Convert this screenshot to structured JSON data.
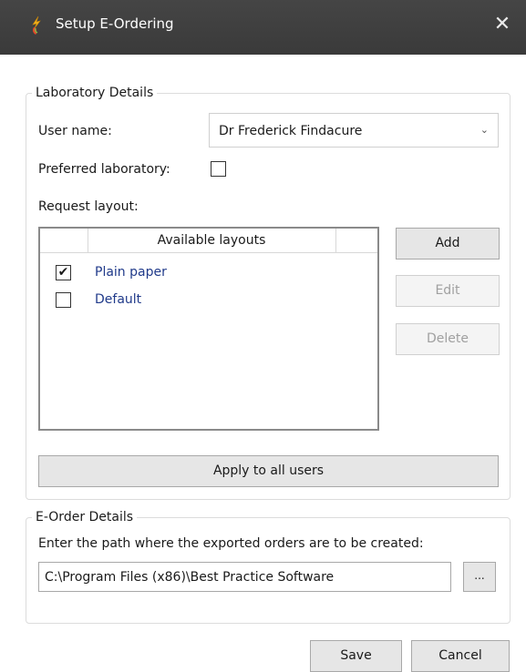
{
  "window": {
    "title": "Setup E-Ordering",
    "close_symbol": "✕",
    "icon": "app-icon"
  },
  "laboratory_details": {
    "legend": "Laboratory Details",
    "user_name_label": "User name:",
    "user_name_value": "Dr Frederick Findacure",
    "preferred_lab_label": "Preferred laboratory:",
    "preferred_lab_checked": false,
    "request_layout_label": "Request layout:",
    "layouts_header": "Available layouts",
    "layouts": [
      {
        "name": "Plain paper",
        "checked": true,
        "check_mark": "✔"
      },
      {
        "name": "Default",
        "checked": false,
        "check_mark": ""
      }
    ],
    "buttons": {
      "add": "Add",
      "edit": "Edit",
      "delete": "Delete",
      "apply_all": "Apply to all users"
    }
  },
  "e_order_details": {
    "legend": "E-Order Details",
    "path_label": "Enter the path where the exported orders are to be created:",
    "path_value": "C:\\Program Files (x86)\\Best Practice Software",
    "browse_label": "..."
  },
  "footer": {
    "save": "Save",
    "cancel": "Cancel"
  },
  "colors": {
    "titlebar": "#3f3f3f",
    "link_text": "#203a8a",
    "disabled_text": "#a0a0a0"
  }
}
